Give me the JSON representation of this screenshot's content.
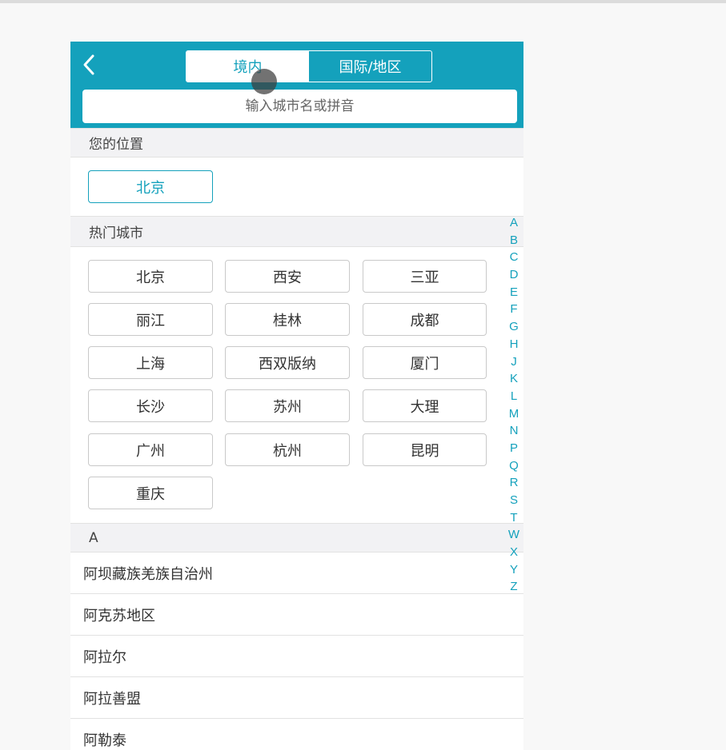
{
  "header": {
    "tabs": [
      {
        "label": "境内",
        "active": true
      },
      {
        "label": "国际/地区",
        "active": false
      }
    ],
    "search_placeholder": "输入城市名或拼音"
  },
  "location": {
    "title": "您的位置",
    "city": "北京"
  },
  "hot": {
    "title": "热门城市",
    "cities": [
      "北京",
      "西安",
      "三亚",
      "丽江",
      "桂林",
      "成都",
      "上海",
      "西双版纳",
      "厦门",
      "长沙",
      "苏州",
      "大理",
      "广州",
      "杭州",
      "昆明",
      "重庆"
    ]
  },
  "list": {
    "section": "A",
    "items": [
      "阿坝藏族羌族自治州",
      "阿克苏地区",
      "阿拉尔",
      "阿拉善盟",
      "阿勒泰"
    ]
  },
  "index": [
    "A",
    "B",
    "C",
    "D",
    "E",
    "F",
    "G",
    "H",
    "J",
    "K",
    "L",
    "M",
    "N",
    "P",
    "Q",
    "R",
    "S",
    "T",
    "W",
    "X",
    "Y",
    "Z"
  ],
  "colors": {
    "accent": "#14a1bc",
    "section_bg": "#f2f2f4",
    "border": "#c9c9c9"
  }
}
